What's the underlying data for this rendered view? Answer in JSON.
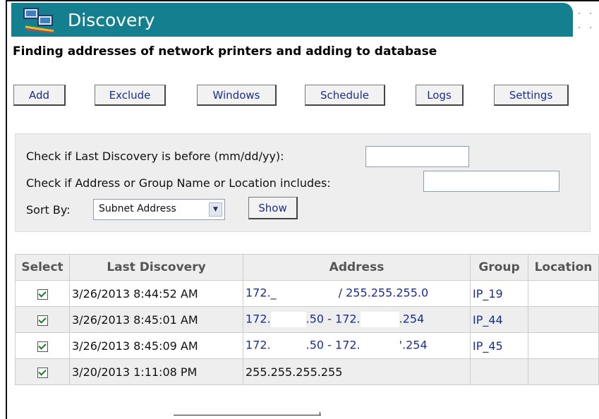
{
  "header": {
    "title": "Discovery",
    "logo_icon": "network-computers-icon",
    "bg_color": "#14808f"
  },
  "subtitle": "Finding addresses of network printers and adding to database",
  "toolbar": {
    "add": "Add",
    "exclude": "Exclude",
    "windows": "Windows",
    "schedule": "Schedule",
    "logs": "Logs",
    "settings": "Settings"
  },
  "filter": {
    "last_discovery_label": "Check if Last Discovery is before (mm/dd/yy):",
    "last_discovery_value": "",
    "includes_label": "Check if Address or Group Name or Location includes:",
    "includes_value": "",
    "sort_label": "Sort By:",
    "sort_value": "Subnet Address",
    "show_button": "Show"
  },
  "table": {
    "columns": [
      "Select",
      "Last Discovery",
      "Address",
      "Group",
      "Location"
    ],
    "rows": [
      {
        "selected": true,
        "last_discovery": "3/26/2013 8:44:52 AM",
        "address_a": "172._",
        "address_b": "/ 255.255.255.0",
        "group": "IP_19",
        "location": ""
      },
      {
        "selected": true,
        "last_discovery": "3/26/2013 8:45:01 AM",
        "address_a": "172.",
        "address_b": ".50 - 172.",
        "address_c": ".254",
        "group": "IP_44",
        "location": ""
      },
      {
        "selected": true,
        "last_discovery": "3/26/2013 8:45:09 AM",
        "address_a": "172.",
        "address_b": ".50 - 172.",
        "address_c": "'.254",
        "group": "IP_45",
        "location": ""
      },
      {
        "selected": true,
        "last_discovery": "3/20/2013 1:11:08 PM",
        "address_a": "255.255.255.255",
        "group": "",
        "location": ""
      }
    ]
  }
}
